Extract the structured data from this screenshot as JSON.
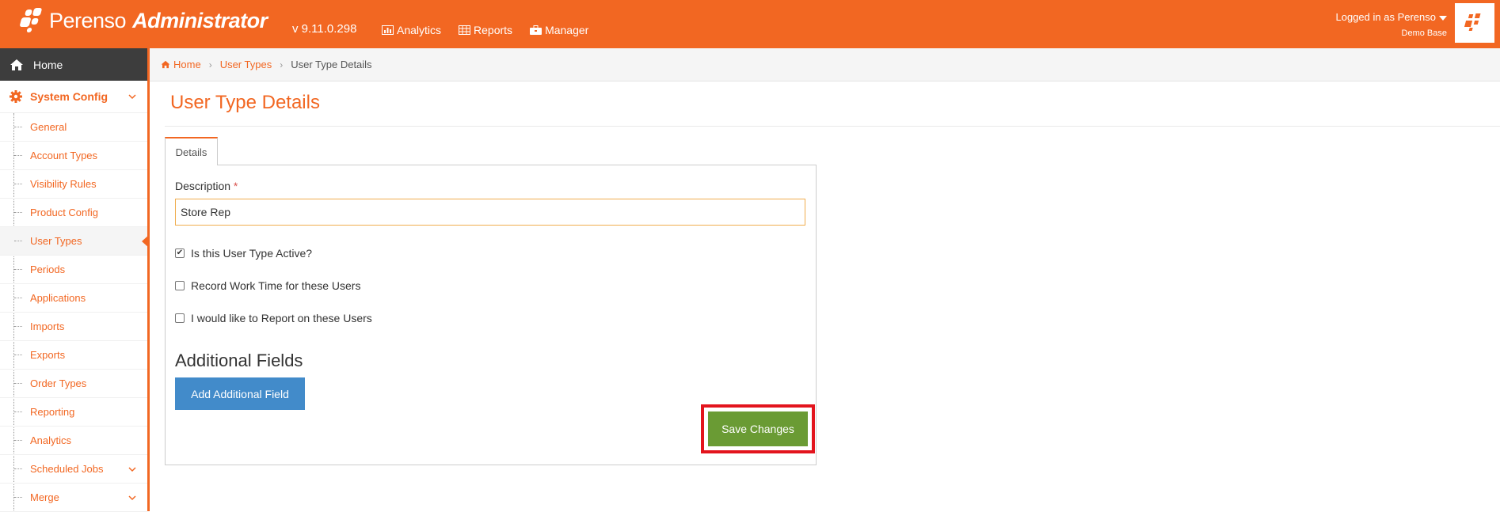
{
  "header": {
    "brand": "Perenso",
    "brand_suffix": "Administrator",
    "version": "v 9.11.0.298",
    "nav": [
      {
        "label": "Analytics",
        "icon": "chart-icon"
      },
      {
        "label": "Reports",
        "icon": "table-icon"
      },
      {
        "label": "Manager",
        "icon": "briefcase-icon"
      }
    ],
    "user_label": "Logged in as Perenso",
    "database": "Demo Base"
  },
  "sidebar": {
    "home": "Home",
    "system_config": "System Config",
    "items": [
      {
        "label": "General"
      },
      {
        "label": "Account Types"
      },
      {
        "label": "Visibility Rules"
      },
      {
        "label": "Product Config"
      },
      {
        "label": "User Types",
        "active": true
      },
      {
        "label": "Periods"
      },
      {
        "label": "Applications"
      },
      {
        "label": "Imports"
      },
      {
        "label": "Exports"
      },
      {
        "label": "Order Types"
      },
      {
        "label": "Reporting"
      },
      {
        "label": "Analytics"
      },
      {
        "label": "Scheduled Jobs",
        "expandable": true
      },
      {
        "label": "Merge",
        "expandable": true
      }
    ]
  },
  "breadcrumb": {
    "home": "Home",
    "parent": "User Types",
    "current": "User Type Details"
  },
  "page": {
    "title": "User Type Details",
    "tab": "Details",
    "description_label": "Description",
    "required_mark": "*",
    "description_value": "Store Rep",
    "checkboxes": [
      {
        "label": "Is this User Type Active?",
        "checked": true
      },
      {
        "label": "Record Work Time for these Users",
        "checked": false
      },
      {
        "label": "I would like to Report on these Users",
        "checked": false
      }
    ],
    "additional_fields_title": "Additional Fields",
    "add_field_button": "Add Additional Field",
    "save_button": "Save Changes"
  },
  "colors": {
    "brand": "#f26722",
    "primary_button": "#428bca",
    "save_button": "#6a9b34",
    "highlight": "#e3141d"
  }
}
